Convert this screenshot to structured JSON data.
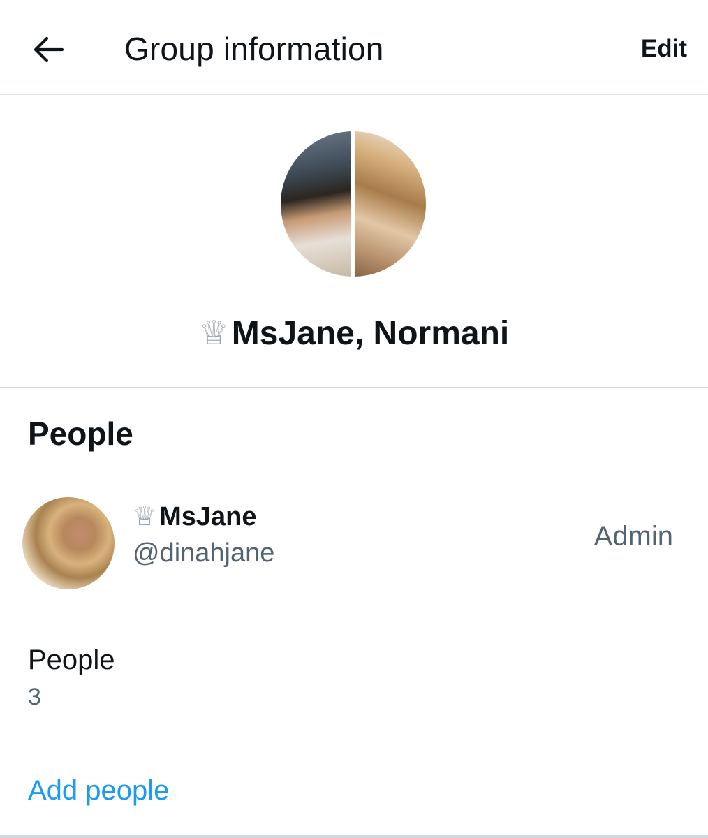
{
  "header": {
    "title": "Group information",
    "edit_label": "Edit",
    "back_icon": "arrow-left-icon"
  },
  "group": {
    "crown_glyph": "♕",
    "name": "MsJane, Normani"
  },
  "people_section": {
    "title": "People",
    "members": [
      {
        "crown_glyph": "♕",
        "display_name": "MsJane",
        "handle": "@dinahjane",
        "role": "Admin"
      }
    ],
    "count_label": "People",
    "count_value": "3",
    "add_label": "Add people"
  },
  "colors": {
    "text_primary": "#0f1419",
    "text_secondary": "#536471",
    "accent": "#1d9bf0",
    "divider": "#cfd9de"
  }
}
